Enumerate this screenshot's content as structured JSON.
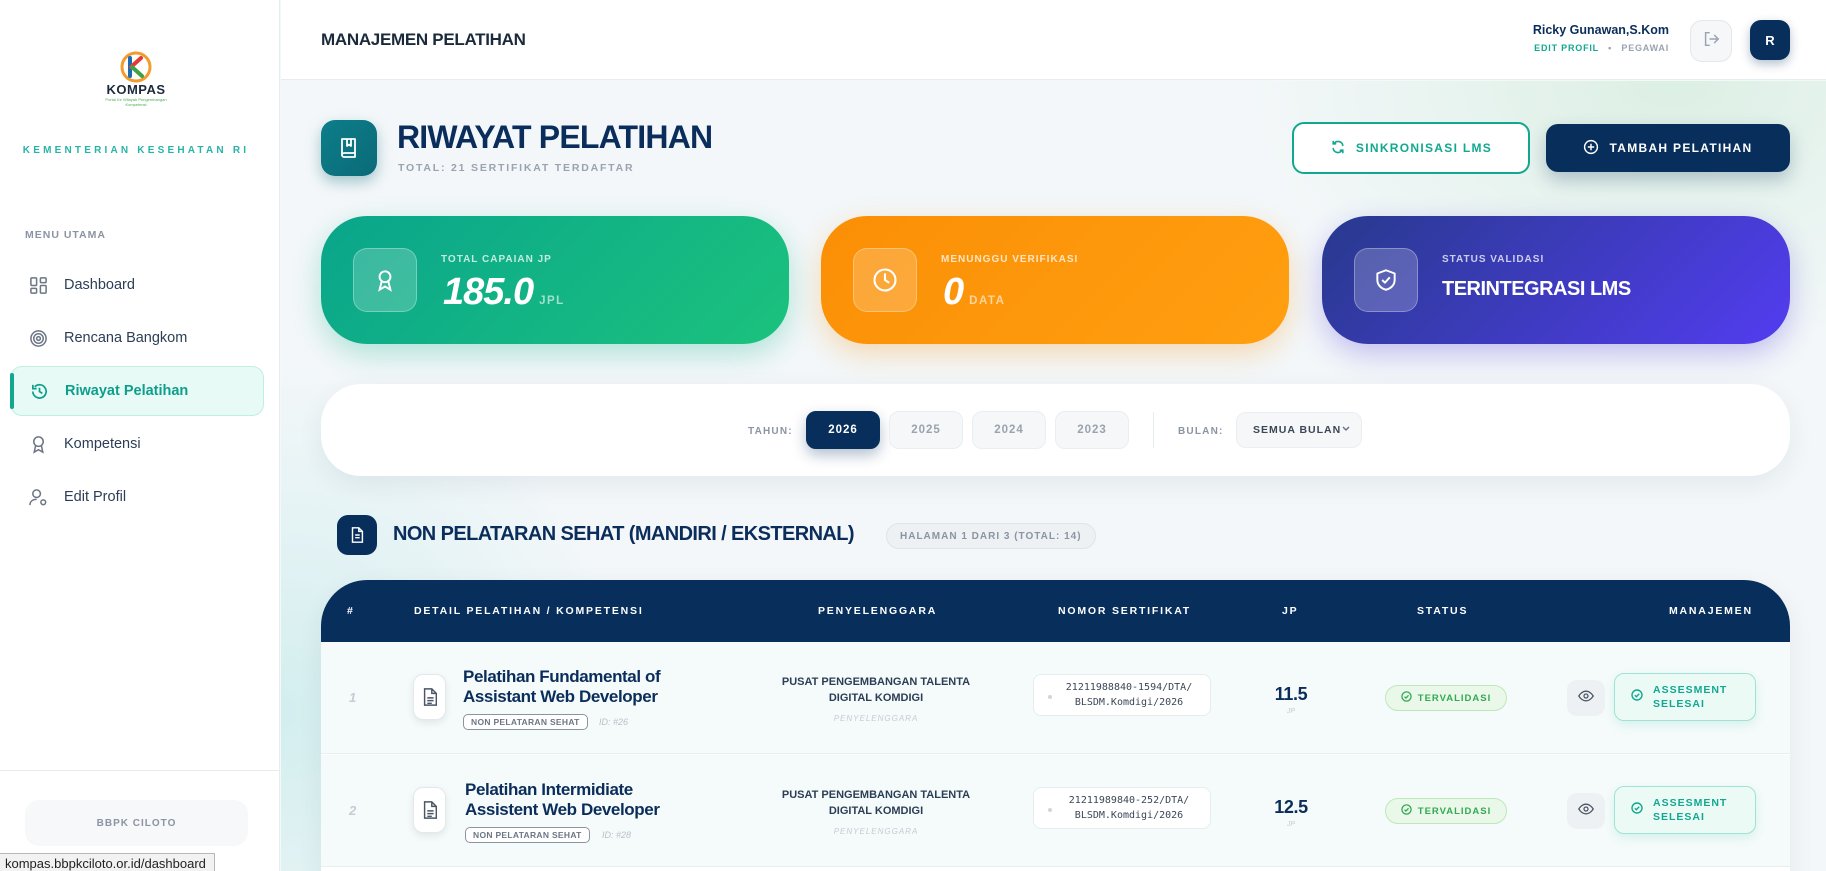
{
  "app": {
    "logo_text": "KOMPAS",
    "logo_tagline": "Portal Ke Wilayah Pengembangan Kompetensi",
    "ministry": "KEMENTERIAN KESEHATAN RI"
  },
  "sidebar": {
    "menu_title": "MENU UTAMA",
    "items": [
      {
        "label": "Dashboard",
        "icon": "dashboard-icon",
        "active": false
      },
      {
        "label": "Rencana Bangkom",
        "icon": "target-icon",
        "active": false
      },
      {
        "label": "Riwayat Pelatihan",
        "icon": "history-icon",
        "active": true
      },
      {
        "label": "Kompetensi",
        "icon": "award-icon",
        "active": false
      },
      {
        "label": "Edit Profil",
        "icon": "user-settings-icon",
        "active": false
      }
    ],
    "footer_label": "BBPK CILOTO"
  },
  "status_bar_url": "kompas.bbpkciloto.or.id/dashboard",
  "header": {
    "title": "MANAJEMEN PELATIHAN",
    "user_name": "Ricky Gunawan,S.Kom",
    "edit_profile": "EDIT PROFIL",
    "separator": "•",
    "role": "PEGAWAI",
    "avatar_initial": "R"
  },
  "page": {
    "title": "RIWAYAT PELATIHAN",
    "subtitle": "TOTAL: 21 SERTIFIKAT TERDAFTAR",
    "sync_button": "SINKRONISASI LMS",
    "add_button": "TAMBAH PELATIHAN"
  },
  "stats": [
    {
      "label": "TOTAL CAPAIAN JP",
      "value": "185.0",
      "unit": "JPL",
      "icon": "award-icon",
      "color": "#10b48c"
    },
    {
      "label": "MENUNGGU VERIFIKASI",
      "value": "0",
      "unit": "DATA",
      "icon": "clock-icon",
      "color": "#fc960a"
    },
    {
      "label": "STATUS VALIDASI",
      "value": "TERINTEGRASI LMS",
      "icon": "shield-check-icon",
      "color": "#3f3ac0"
    }
  ],
  "filter": {
    "year_label": "TAHUN:",
    "years": [
      "2026",
      "2025",
      "2024",
      "2023"
    ],
    "selected_year": "2026",
    "month_label": "BULAN:",
    "month_value": "SEMUA BULAN"
  },
  "section": {
    "title": "NON PELATARAN SEHAT (MANDIRI / EKSTERNAL)",
    "pagination": "HALAMAN 1 DARI 3 (TOTAL: 14)"
  },
  "table": {
    "columns": [
      "#",
      "DETAIL PELATIHAN / KOMPETENSI",
      "PENYELENGGARA",
      "NOMOR SERTIFIKAT",
      "JP",
      "STATUS",
      "MANAJEMEN"
    ],
    "rows": [
      {
        "no": "1",
        "title": "Pelatihan Fundamental of Assistant Web Developer",
        "tag": "NON PELATARAN SEHAT",
        "id": "ID: #26",
        "org": "PUSAT PENGEMBANGAN TALENTA DIGITAL KOMDIGI",
        "org_sub": "PENYELENGGARA",
        "cert_line1": "21211988840-1594/DTA/",
        "cert_line2": "BLSDM.Komdigi/2026",
        "jp": "11.5",
        "jp_unit": "JP",
        "status": "TERVALIDASI",
        "action_line1": "ASSESMENT",
        "action_line2": "SELESAI"
      },
      {
        "no": "2",
        "title": "Pelatihan Intermidiate Assistent Web Developer",
        "tag": "NON PELATARAN SEHAT",
        "id": "ID: #28",
        "org": "PUSAT PENGEMBANGAN TALENTA DIGITAL KOMDIGI",
        "org_sub": "PENYELENGGARA",
        "cert_line1": "21211989840-252/DTA/",
        "cert_line2": "BLSDM.Komdigi/2026",
        "jp": "12.5",
        "jp_unit": "JP",
        "status": "TERVALIDASI",
        "action_line1": "ASSESMENT",
        "action_line2": "SELESAI"
      }
    ]
  }
}
